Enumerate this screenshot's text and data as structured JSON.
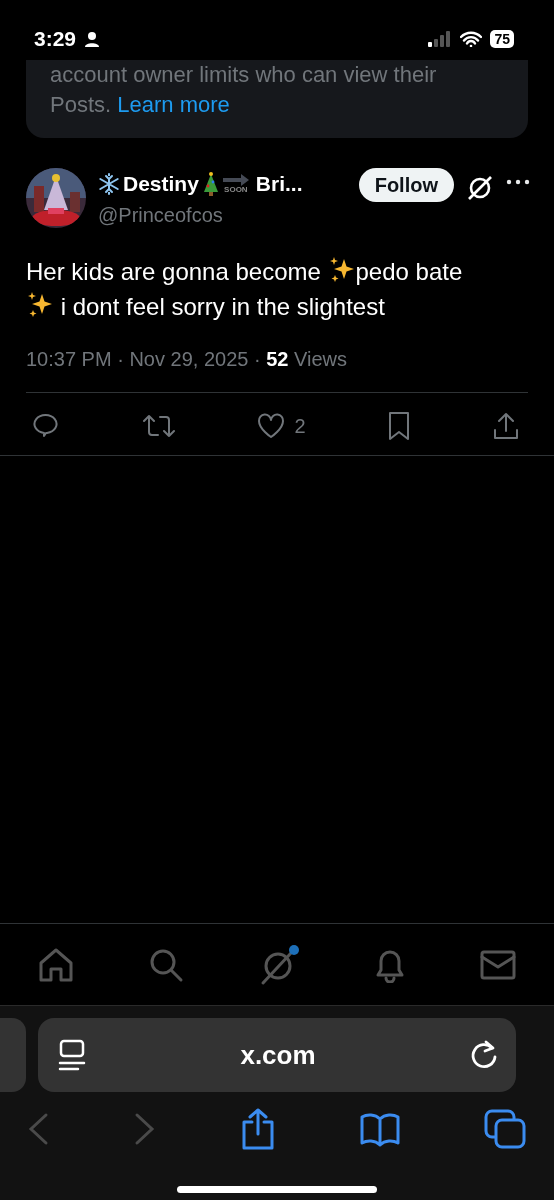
{
  "status_bar": {
    "time": "3:29",
    "battery": "75"
  },
  "notice": {
    "line_1": "account owner limits who can view their",
    "line_2": "Posts.",
    "link": "Learn more"
  },
  "post": {
    "author": {
      "name": "Destiny",
      "soon_label": "SOON",
      "name_rest": "Bri...",
      "handle": "@Princeofcos"
    },
    "follow_button": "Follow",
    "text_parts": [
      {
        "kind": "text",
        "text": "Her kids are gonna become "
      },
      {
        "kind": "sparkles"
      },
      {
        "kind": "text",
        "text": "pedo bate"
      },
      {
        "kind": "break"
      },
      {
        "kind": "sparkles"
      },
      {
        "kind": "text",
        "text": " i dont feel sorry in the slightest"
      }
    ],
    "time": "10:37 PM",
    "separator_1": "·",
    "date": "Nov 29, 2025",
    "separator_2": "·",
    "views_count": "52",
    "views_label": "Views",
    "likes": "2"
  },
  "bottom_nav": [
    {
      "kind": "home"
    },
    {
      "kind": "search"
    },
    {
      "kind": "grok",
      "badge": true
    },
    {
      "kind": "bell"
    },
    {
      "kind": "mail"
    }
  ],
  "browser": {
    "url": "x.com"
  }
}
